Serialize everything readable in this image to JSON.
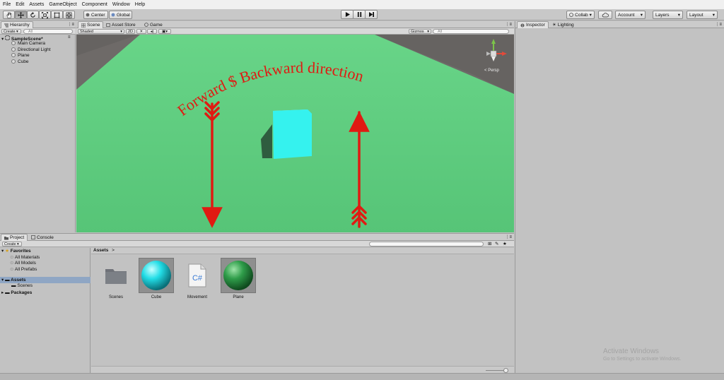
{
  "menu": [
    "File",
    "Edit",
    "Assets",
    "GameObject",
    "Component",
    "Window",
    "Help"
  ],
  "toolbar": {
    "tools": [
      "hand-tool-icon",
      "move-tool-icon",
      "rotate-tool-icon",
      "scale-tool-icon",
      "rect-tool-icon",
      "transform-tool-icon"
    ],
    "pivot": "Center",
    "space": "Global",
    "collab": "Collab",
    "account": "Account",
    "layers": "Layers",
    "layout": "Layout"
  },
  "hierarchy": {
    "tab": "Hierarchy",
    "create": "Create",
    "search_placeholder": "All",
    "scene": "SampleScene*",
    "items": [
      "Main Camera",
      "Directional Light",
      "Plane",
      "Cube"
    ]
  },
  "scene_view": {
    "tabs": [
      "Scene",
      "Asset Store",
      "Game"
    ],
    "shading": "Shaded",
    "mode_2d": "2D",
    "gizmos": "Gizmos",
    "search_placeholder": "All",
    "persp": "Persp",
    "annotation": "Forward $ Backward direction",
    "colors": {
      "ground": "#5ccb7d",
      "sky": "#6e6a68",
      "cube": "#35f2ee",
      "arrow": "#e01a12"
    }
  },
  "inspector": {
    "tabs": [
      "Inspector",
      "Lighting"
    ]
  },
  "project": {
    "tabs": [
      "Project",
      "Console"
    ],
    "create": "Create",
    "favorites_label": "Favorites",
    "favorites": [
      "All Materials",
      "All Models",
      "All Prefabs"
    ],
    "assets_label": "Assets",
    "assets_children": [
      "Scenes"
    ],
    "packages_label": "Packages",
    "breadcrumb": "Assets",
    "breadcrumb_sep": ">",
    "files": [
      {
        "name": "Scenes",
        "icon": "folder-icon"
      },
      {
        "name": "Cube",
        "icon": "cyan-material-icon"
      },
      {
        "name": "Movement",
        "icon": "csharp-script-icon",
        "badge": "C#"
      },
      {
        "name": "Plane",
        "icon": "green-material-icon"
      }
    ]
  },
  "watermark": {
    "title": "Activate Windows",
    "subtitle": "Go to Settings to activate Windows."
  }
}
